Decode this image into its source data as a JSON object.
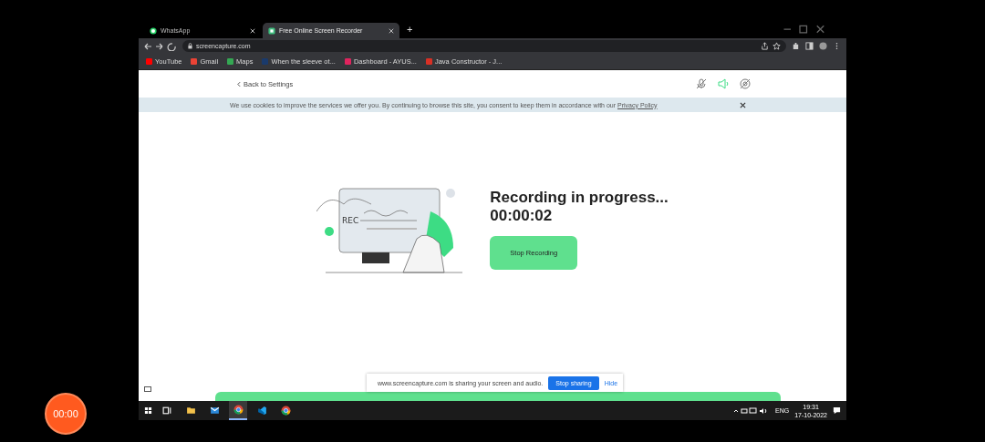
{
  "browser": {
    "tabs": [
      {
        "title": "WhatsApp",
        "kind": "whatsapp",
        "selected": false
      },
      {
        "title": "Free Online Screen Recorder",
        "kind": "site",
        "selected": true
      }
    ],
    "new_tab": "+",
    "address": "screencapture.com",
    "bookmarks": [
      {
        "label": "YouTube",
        "color": "#ff0000"
      },
      {
        "label": "Gmail",
        "color": "#ea4335"
      },
      {
        "label": "Maps",
        "color": "#34a853"
      },
      {
        "label": "When the sleeve ot...",
        "color": "#1a3a6b"
      },
      {
        "label": "Dashboard - AYUS...",
        "color": "#e0245e"
      },
      {
        "label": "Java Constructor - J...",
        "color": "#d93025"
      }
    ]
  },
  "page": {
    "back_link": "Back to Settings",
    "toggles": [
      {
        "kind": "mic",
        "on": false
      },
      {
        "kind": "speaker",
        "on": true
      },
      {
        "kind": "camera",
        "on": false
      }
    ],
    "cookie": {
      "text": "We use cookies to improve the services we offer you. By continuing to browse this site, you consent to keep them in accordance with our",
      "link": "Privacy Policy"
    },
    "illustration_label": "REC",
    "heading": "Recording in progress...",
    "timer": "00:00:02",
    "stop_button": "Stop Recording",
    "share_bar": {
      "text": "www.screencapture.com is sharing your screen and audio.",
      "button": "Stop sharing",
      "link": "Hide"
    }
  },
  "taskbar": {
    "apps": [
      {
        "kind": "task-view",
        "selected": false
      },
      {
        "kind": "folder",
        "selected": false
      },
      {
        "kind": "mail",
        "selected": false
      },
      {
        "kind": "chrome",
        "selected": true
      },
      {
        "kind": "code",
        "selected": false
      },
      {
        "kind": "chrome",
        "selected": false
      }
    ],
    "language": "ENG",
    "time": "19:31",
    "date": "17-10-2022"
  },
  "recorder_timer": "00:00"
}
